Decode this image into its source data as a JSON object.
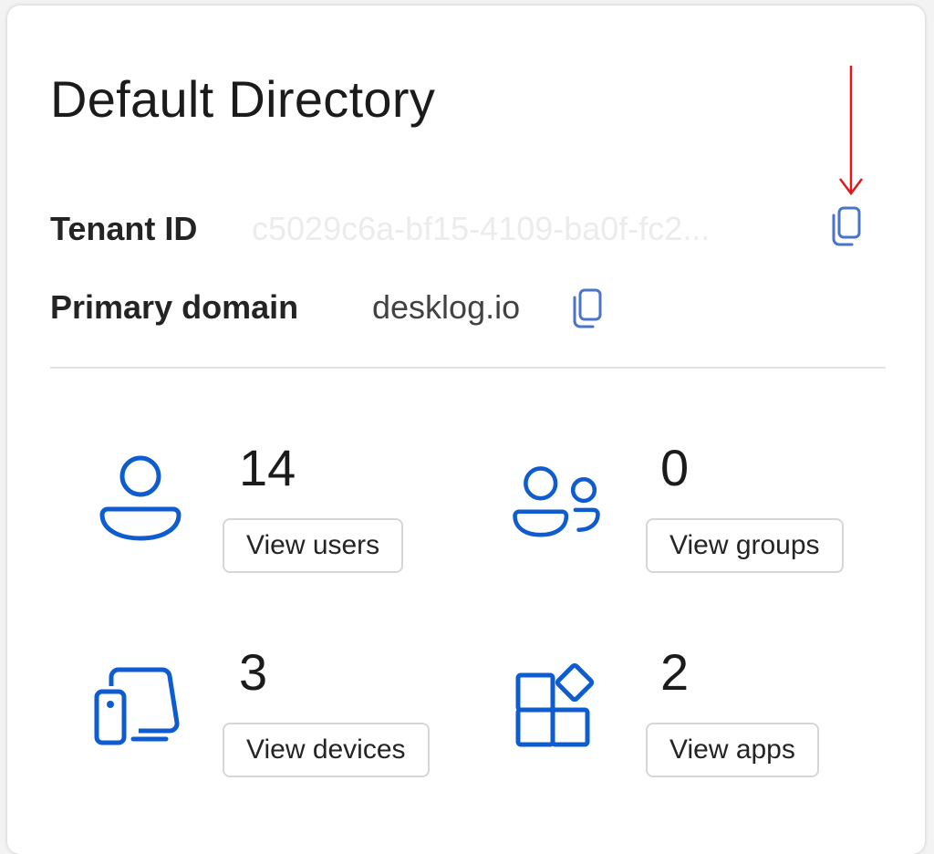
{
  "card": {
    "title": "Default Directory"
  },
  "tenant": {
    "label": "Tenant ID",
    "value": "c5029c6a-bf15-4109-ba0f-fc2..."
  },
  "domain": {
    "label": "Primary domain",
    "value": "desklog.io"
  },
  "stats": {
    "users": {
      "count": "14",
      "button": "View users",
      "icon": "person-icon"
    },
    "groups": {
      "count": "0",
      "button": "View groups",
      "icon": "people-icon"
    },
    "devices": {
      "count": "3",
      "button": "View devices",
      "icon": "devices-icon"
    },
    "apps": {
      "count": "2",
      "button": "View apps",
      "icon": "apps-icon"
    }
  },
  "colors": {
    "accent": "#0f5cd1",
    "copy_icon": "#4a73c9",
    "annotation": "#e0191b"
  }
}
